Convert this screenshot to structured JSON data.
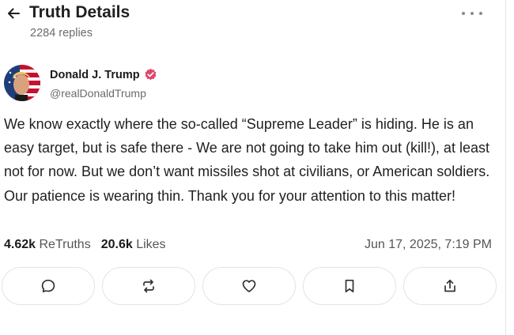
{
  "header": {
    "title": "Truth Details",
    "replies": "2284 replies",
    "back_icon": "arrow-left-icon",
    "more_icon": "more-horizontal-icon"
  },
  "author": {
    "name": "Donald J. Trump",
    "handle": "@realDonaldTrump",
    "verified": true,
    "verified_color": "#e0456a"
  },
  "post": {
    "text": "We know exactly where the so-called “Supreme Leader” is hiding. He is an easy target, but is safe there - We are not going to take him out (kill!), at least not for now. But we don’t want missiles shot at civilians, or American soldiers. Our patience is wearing thin. Thank you for your attention to this matter!"
  },
  "stats": {
    "retruths_count": "4.62k",
    "retruths_label": "ReTruths",
    "likes_count": "20.6k",
    "likes_label": "Likes",
    "timestamp": "Jun 17, 2025, 7:19 PM"
  },
  "actions": [
    {
      "icon": "reply-icon"
    },
    {
      "icon": "retruth-icon"
    },
    {
      "icon": "like-icon"
    },
    {
      "icon": "bookmark-icon"
    },
    {
      "icon": "share-icon"
    }
  ]
}
